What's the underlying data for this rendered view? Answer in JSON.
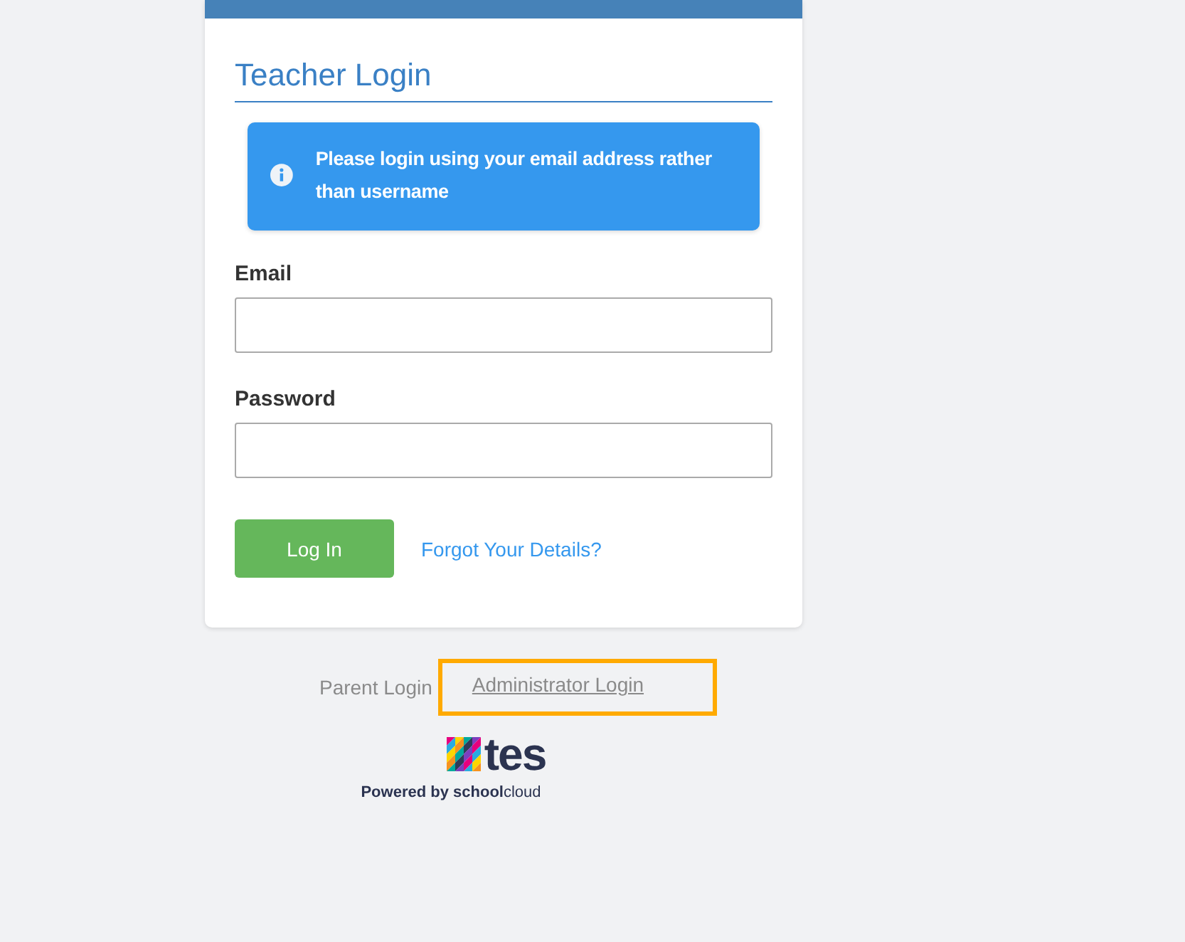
{
  "card": {
    "title": "Teacher Login",
    "alert": {
      "text": "Please login using your email address rather than username"
    },
    "fields": [
      {
        "label": "Email"
      },
      {
        "label": "Password"
      }
    ],
    "login_button": "Log In",
    "forgot_link": "Forgot Your Details?"
  },
  "footer_links": [
    {
      "label": "Parent Login",
      "underlined": false,
      "highlighted": false
    },
    {
      "label": "Administrator Login",
      "underlined": true,
      "highlighted": true
    }
  ],
  "brand": {
    "logo_text": "tes",
    "powered_by": "**Powered by school**cloud"
  }
}
